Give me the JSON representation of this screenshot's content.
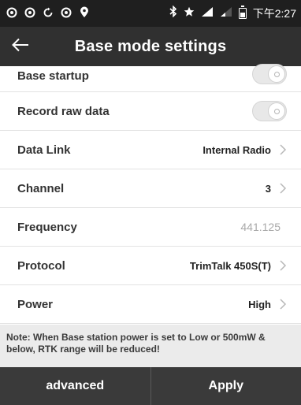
{
  "status_bar": {
    "left_icons": [
      "notification-icon",
      "notification-icon",
      "sync-icon",
      "notification-icon",
      "location-pin-icon"
    ],
    "right_icons": [
      "bluetooth-icon",
      "star-icon",
      "signal-icon",
      "signal-weak-icon",
      "battery-icon"
    ],
    "time": "下午2:27"
  },
  "header": {
    "back_icon": "arrow-left-icon",
    "title": "Base mode settings"
  },
  "settings": {
    "base_startup": {
      "label": "Base startup",
      "enabled": false
    },
    "record_raw_data": {
      "label": "Record raw data",
      "enabled": false
    },
    "data_link": {
      "label": "Data Link",
      "value": "Internal Radio"
    },
    "channel": {
      "label": "Channel",
      "value": "3"
    },
    "frequency": {
      "label": "Frequency",
      "value": "441.125"
    },
    "protocol": {
      "label": "Protocol",
      "value": "TrimTalk 450S(T)"
    },
    "power": {
      "label": "Power",
      "value": "High"
    }
  },
  "note": "Note: When Base station power is set to Low or 500mW & below, RTK range will be reduced!",
  "bottom_bar": {
    "advanced_label": "advanced",
    "apply_label": "Apply"
  },
  "colors": {
    "status_bar_bg": "#1f1f1f",
    "header_bg": "#303030",
    "bottom_bar_bg": "#3a3a3a",
    "note_bg": "#ebebeb",
    "muted_value": "#a8a8a8"
  }
}
